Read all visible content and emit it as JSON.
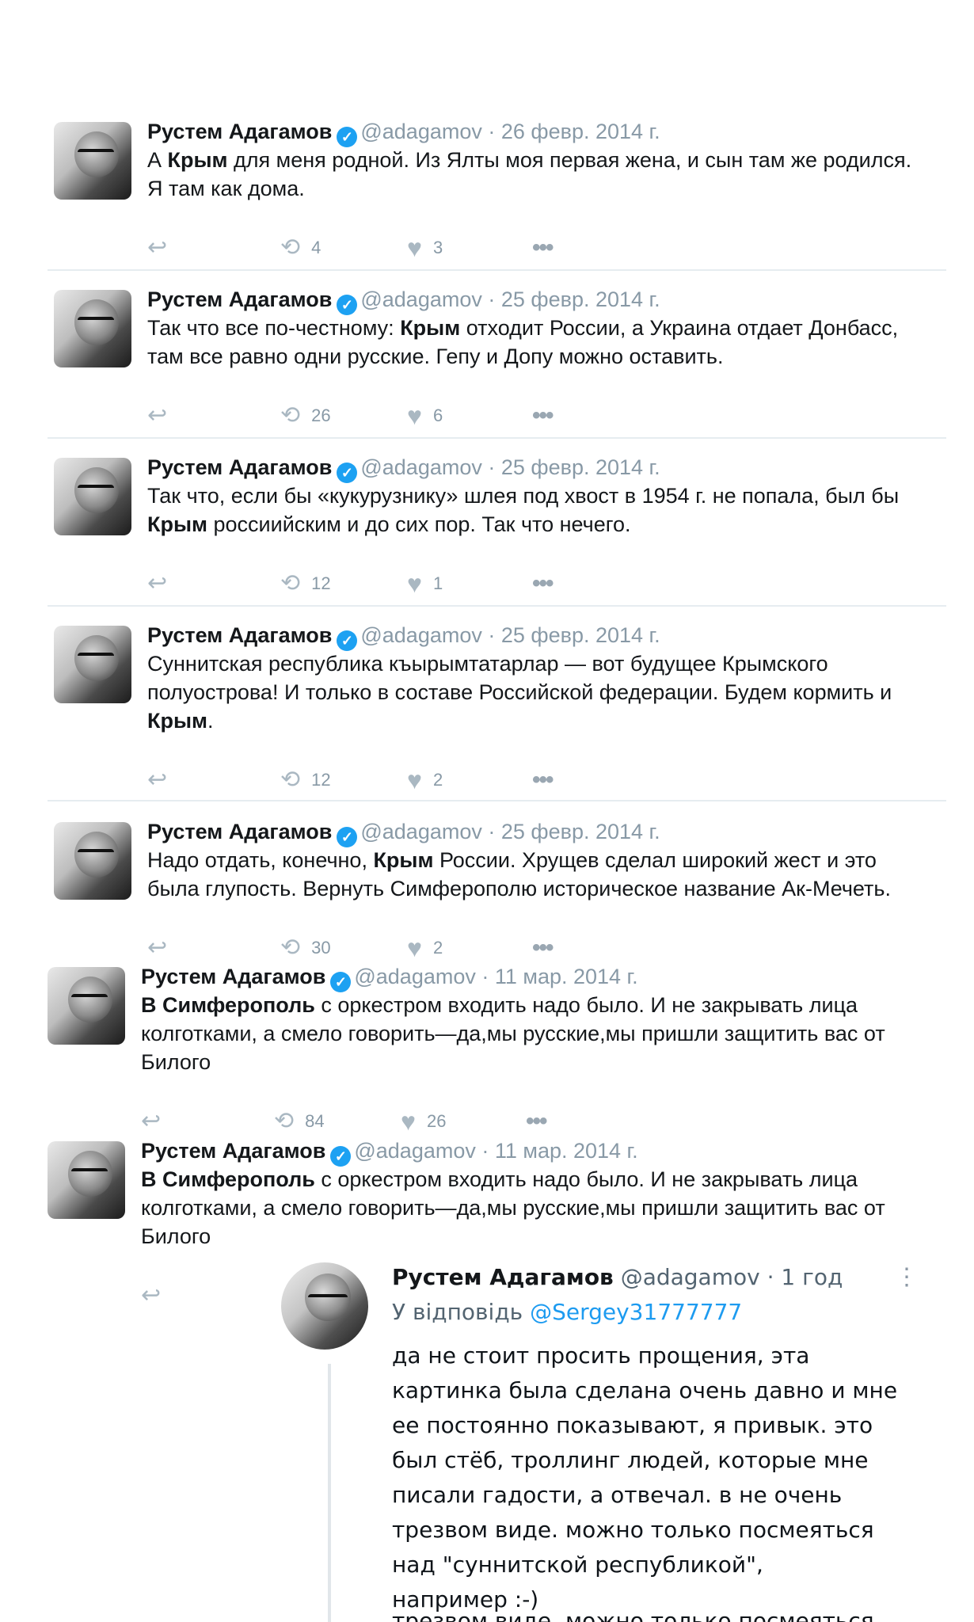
{
  "tweets": [
    {
      "name": "Рустем Адагамов",
      "handle": "@adagamov",
      "sep": "·",
      "date": "26 февр. 2014 г.",
      "lines": [
        [
          {
            "t": "А "
          },
          {
            "t": "Крым",
            "b": true
          },
          {
            "t": " для меня родной. Из Ялты моя первая жена, и сын там же родился."
          }
        ],
        [
          {
            "t": "Я там как дома."
          }
        ]
      ],
      "retweets": "4",
      "likes": "3"
    },
    {
      "name": "Рустем Адагамов",
      "handle": "@adagamov",
      "sep": "·",
      "date": "25 февр. 2014 г.",
      "lines": [
        [
          {
            "t": "Так что все по-честному: "
          },
          {
            "t": "Крым",
            "b": true
          },
          {
            "t": " отходит России, а Украина отдает Донбасс,"
          }
        ],
        [
          {
            "t": "там все равно одни русские. Гепу и Допу можно оставить."
          }
        ]
      ],
      "retweets": "26",
      "likes": "6"
    },
    {
      "name": "Рустем Адагамов",
      "handle": "@adagamov",
      "sep": "·",
      "date": "25 февр. 2014 г.",
      "lines": [
        [
          {
            "t": "Так что, если бы «кукурузнику» шлея под хвост в 1954 г. не попала, был бы"
          }
        ],
        [
          {
            "t": "Крым",
            "b": true
          },
          {
            "t": " россиийским и до сих пор. Так что нечего."
          }
        ]
      ],
      "retweets": "12",
      "likes": "1"
    },
    {
      "name": "Рустем Адагамов",
      "handle": "@adagamov",
      "sep": "·",
      "date": "25 февр. 2014 г.",
      "lines": [
        [
          {
            "t": "Суннитская республика къырымтатарлар — вот будущее Крымского"
          }
        ],
        [
          {
            "t": "полуострова! И только в составе Российской федерации. Будем кормить и"
          }
        ],
        [
          {
            "t": "Крым",
            "b": true
          },
          {
            "t": "."
          }
        ]
      ],
      "retweets": "12",
      "likes": "2"
    },
    {
      "name": "Рустем Адагамов",
      "handle": "@adagamov",
      "sep": "·",
      "date": "25 февр. 2014 г.",
      "lines": [
        [
          {
            "t": "Надо отдать, конечно, "
          },
          {
            "t": "Крым",
            "b": true
          },
          {
            "t": " России. Хрущев сделал широкий жест и это"
          }
        ],
        [
          {
            "t": "была глупость. Вернуть Симферополю историческое название Ак-Мечеть."
          }
        ]
      ],
      "retweets": "30",
      "likes": "2"
    },
    {
      "name": "Рустем Адагамов",
      "handle": "@adagamov",
      "sep": "·",
      "date": "11 мар. 2014 г.",
      "lines": [
        [
          {
            "t": "В Симферополь",
            "b": true
          },
          {
            "t": " с оркестром входить надо было. И не закрывать лица"
          }
        ],
        [
          {
            "t": "колготками, а смело говорить—да,мы русские,мы пришли защитить вас от"
          }
        ],
        [
          {
            "t": "Билого"
          }
        ]
      ],
      "retweets": "84",
      "likes": "26"
    },
    {
      "name": "Рустем Адагамов",
      "handle": "@adagamov",
      "sep": "·",
      "date": "11 мар. 2014 г.",
      "lines": [
        [
          {
            "t": "В Симферополь",
            "b": true
          },
          {
            "t": " с оркестром входить надо было. И не закрывать лица"
          }
        ],
        [
          {
            "t": "колготками, а смело говорить—да,мы русские,мы пришли защитить вас от"
          }
        ],
        [
          {
            "t": "Билого"
          }
        ]
      ],
      "retweets": "",
      "likes": ""
    }
  ],
  "icons": {
    "reply": "reply-arrow-icon",
    "retweet": "retweet-icon",
    "like": "heart-icon",
    "more": "more-dots-icon",
    "verified": "verified-badge-icon"
  },
  "reply": {
    "name": "Рустем Адагамов",
    "handle": "@adagamov",
    "time": "· 1 год",
    "reply_to_prefix": "У відповідь",
    "reply_to_mention": "@Sergey31777777",
    "text_lines": [
      "да не стоит просить прощения, эта",
      "картинка была сделана очень давно и мне",
      "ее постоянно показывают, я привык. это",
      "был стёб, троллинг людей, которые мне",
      "писали гадости, а отвечал. в не очень",
      "трезвом виде. можно только посмеяться",
      "над \"суннитской республикой\",",
      "например :-)"
    ],
    "cut_off_line": "трезвом виде. можно только посмеяться"
  },
  "colors": {
    "verified": "#1da1f2",
    "mention": "#1d9bf0",
    "muted": "#8899a6"
  }
}
